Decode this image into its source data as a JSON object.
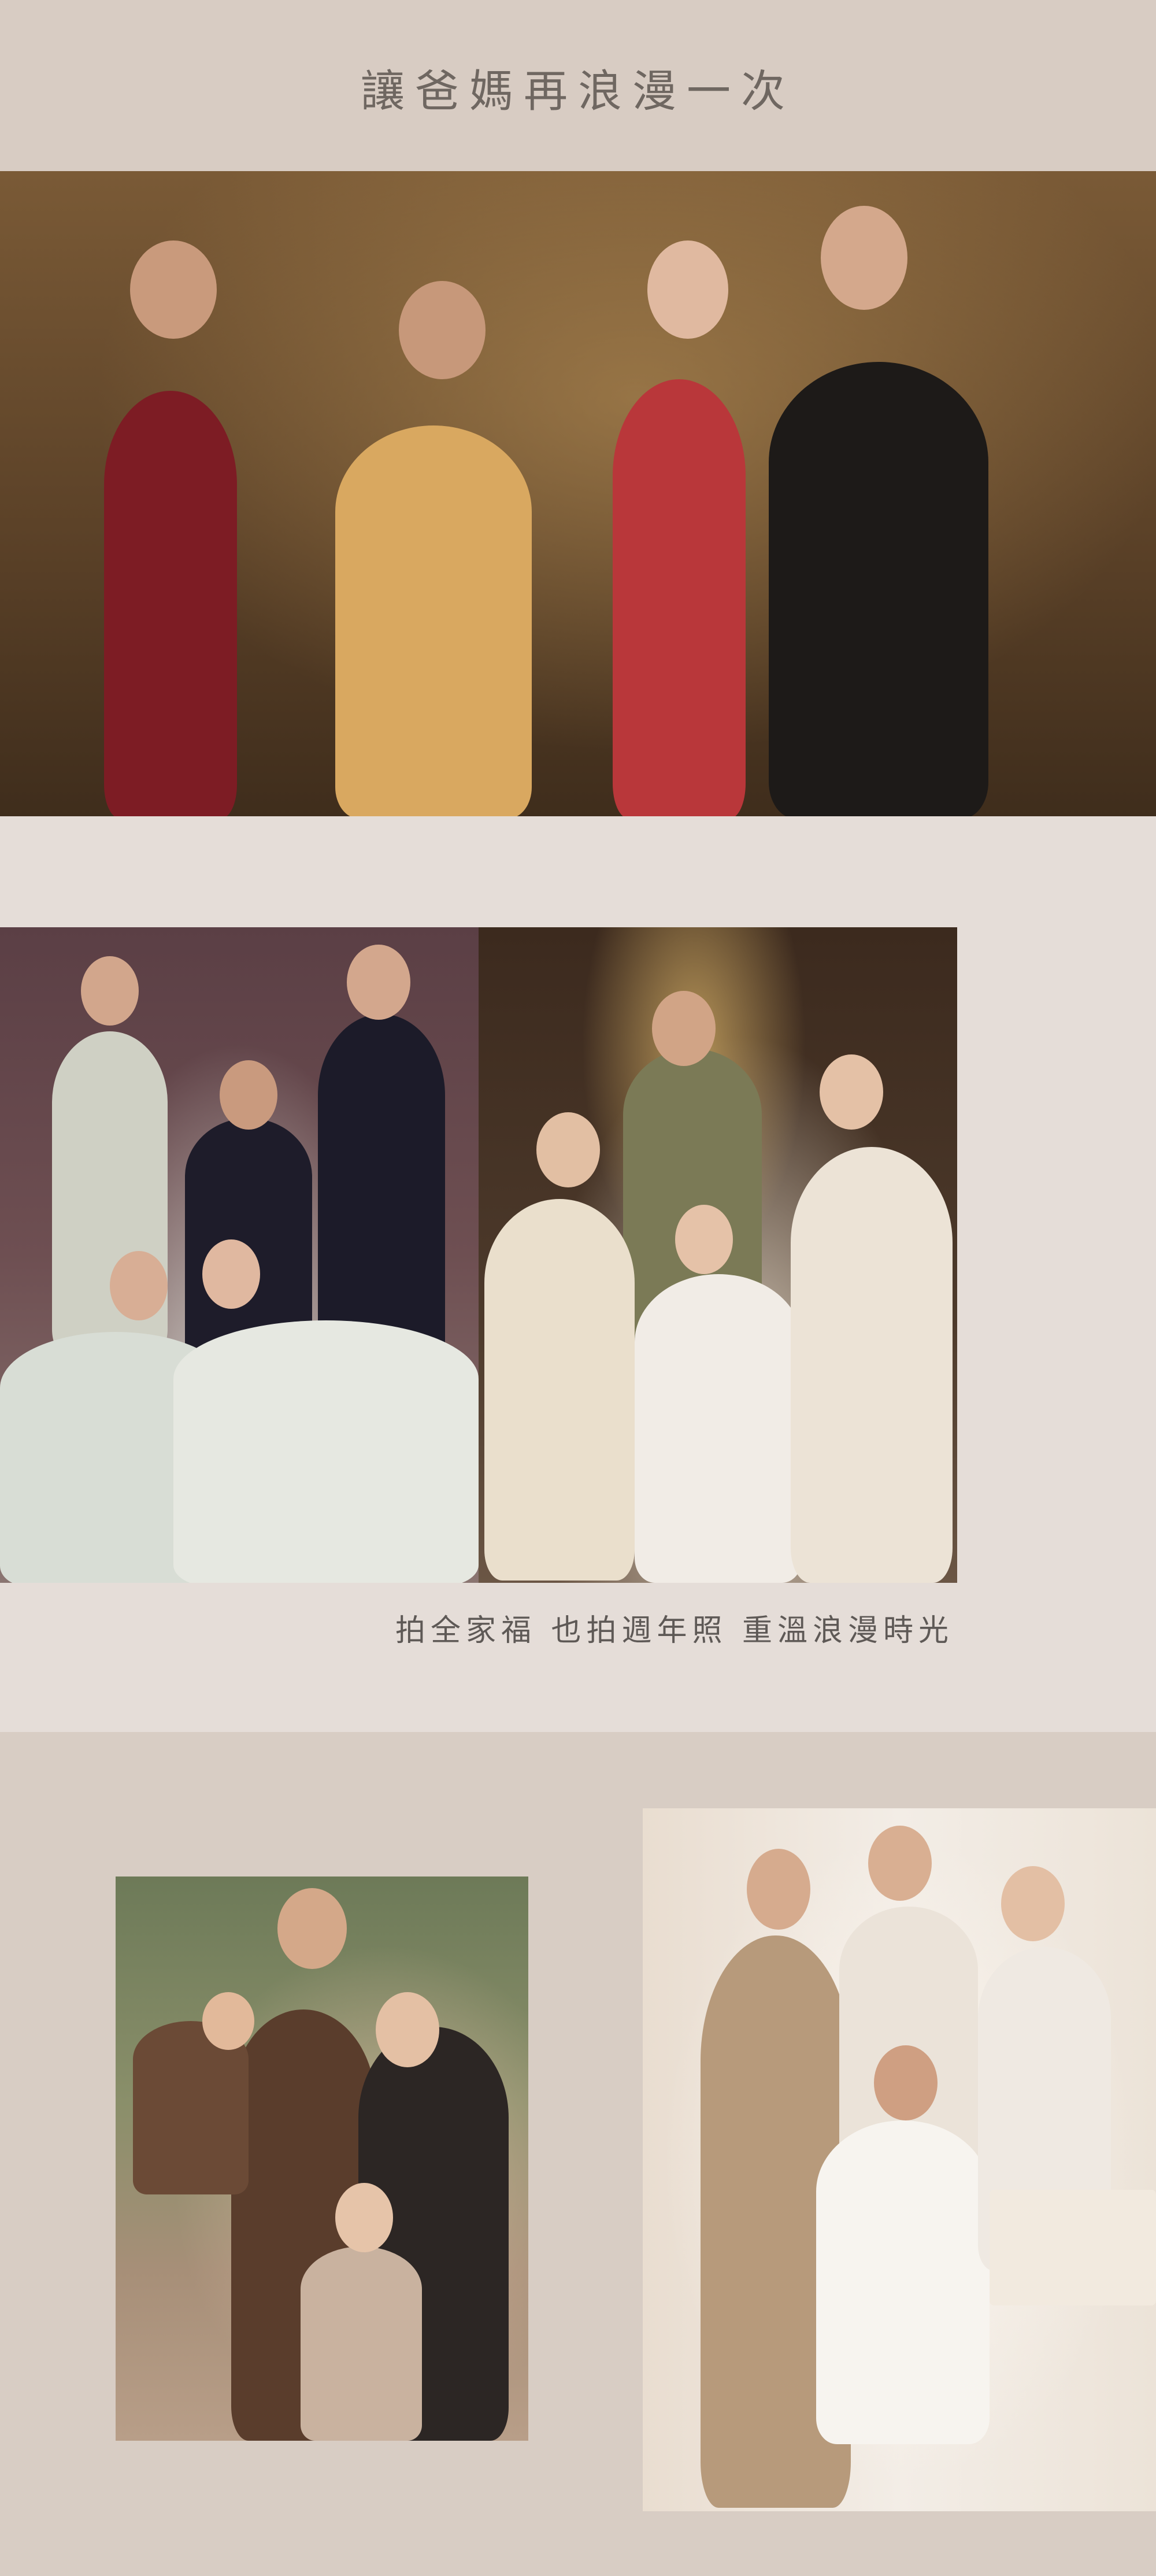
{
  "heading": "讓爸媽再浪漫一次",
  "caption": "拍全家福  也拍週年照  重溫浪漫時光",
  "colors": {
    "title_band": "#d8ccc3",
    "family_band": "#e5ddd8",
    "bottom_band": "#d8cdc4",
    "heading_text": "#6f6761",
    "caption_text": "#5e5956"
  }
}
